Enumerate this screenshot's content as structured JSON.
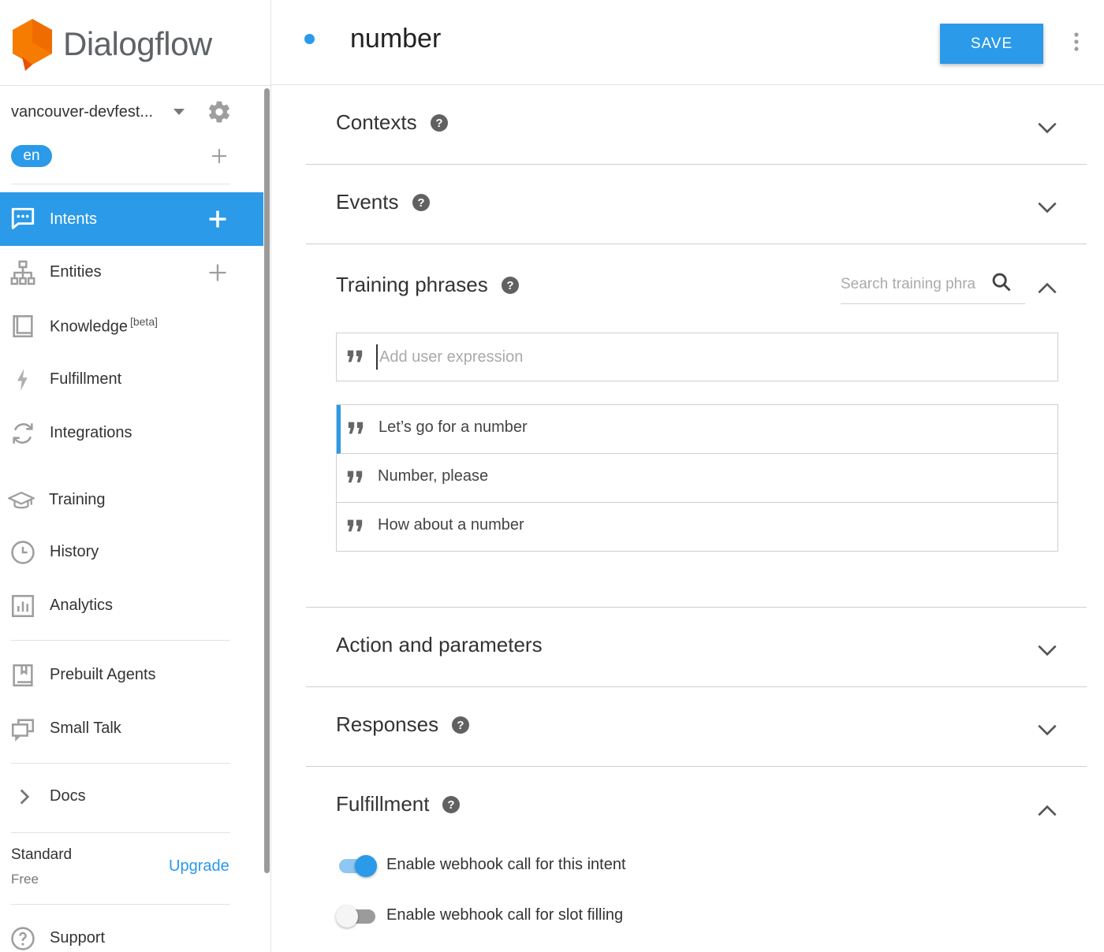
{
  "app": {
    "name": "Dialogflow"
  },
  "colors": {
    "accent": "#2b9ae8",
    "logo": "#f57c00",
    "text": "#333333"
  },
  "sidebar": {
    "agent_name": "vancouver-devfest...",
    "language": "en",
    "items": [
      {
        "label": "Intents",
        "icon": "chat-icon",
        "active": true,
        "has_add": true
      },
      {
        "label": "Entities",
        "icon": "hierarchy-icon",
        "active": false,
        "has_add": true
      },
      {
        "label": "Knowledge",
        "icon": "book-icon",
        "badge": "[beta]",
        "active": false
      },
      {
        "label": "Fulfillment",
        "icon": "lightning-icon",
        "active": false
      },
      {
        "label": "Integrations",
        "icon": "sync-icon",
        "active": false
      },
      {
        "label": "Training",
        "icon": "graduation-cap-icon",
        "active": false
      },
      {
        "label": "History",
        "icon": "clock-icon",
        "active": false
      },
      {
        "label": "Analytics",
        "icon": "bar-chart-icon",
        "active": false
      },
      {
        "label": "Prebuilt Agents",
        "icon": "bookmark-icon",
        "active": false
      },
      {
        "label": "Small Talk",
        "icon": "chat-bubbles-icon",
        "active": false
      },
      {
        "label": "Docs",
        "icon": "chevron-right-icon",
        "active": false
      },
      {
        "label": "Support",
        "icon": "help-circle-icon",
        "active": false
      }
    ],
    "plan": {
      "name": "Standard",
      "type": "Free",
      "upgrade_label": "Upgrade"
    }
  },
  "header": {
    "intent_name": "number",
    "save_label": "SAVE"
  },
  "sections": {
    "contexts": {
      "title": "Contexts",
      "expanded": false
    },
    "events": {
      "title": "Events",
      "expanded": false
    },
    "training": {
      "title": "Training phrases",
      "expanded": true,
      "search_placeholder": "Search training phra",
      "expression_placeholder": "Add user expression",
      "phrases": [
        "Let’s go for a number",
        "Number, please",
        "How about a number"
      ]
    },
    "action": {
      "title": "Action and parameters",
      "expanded": false
    },
    "responses": {
      "title": "Responses",
      "expanded": false
    },
    "fulfillment": {
      "title": "Fulfillment",
      "expanded": true,
      "toggles": [
        {
          "label": "Enable webhook call for this intent",
          "on": true
        },
        {
          "label": "Enable webhook call for slot filling",
          "on": false
        }
      ]
    }
  }
}
